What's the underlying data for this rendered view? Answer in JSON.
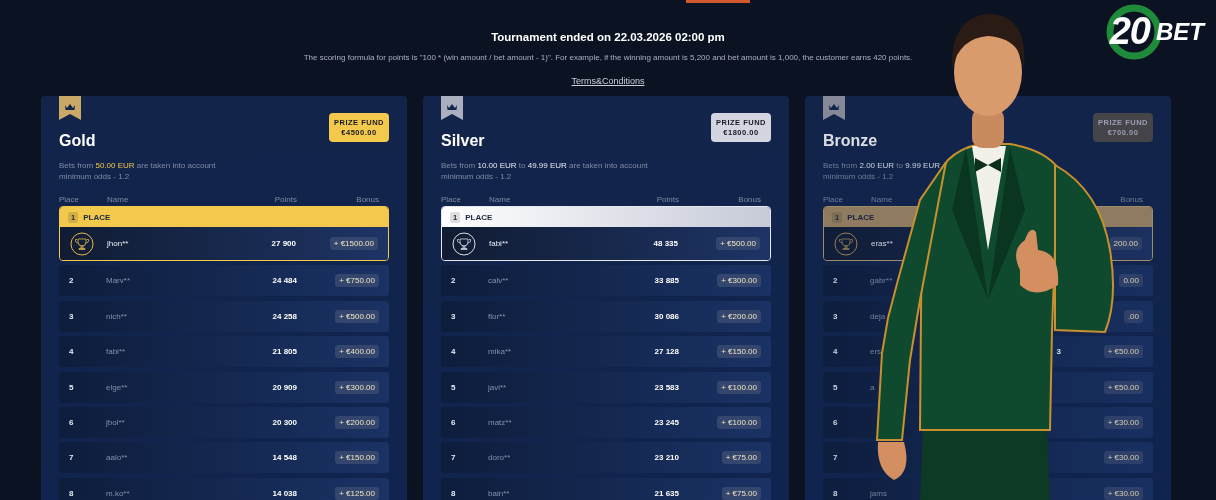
{
  "logo": {
    "number": "20",
    "text": "BET"
  },
  "header": {
    "title": "Tournament ended on 22.03.2026 02:00 pm",
    "formula": "The scoring formula for points is \"100 * (win amount / bet amount - 1)\". For example, if the winning amount is 5,200 and bet amount is 1,000, the customer earns 420 points.",
    "terms_link": "Terms&Conditions"
  },
  "tiers": [
    {
      "kind": "gold",
      "name": "Gold",
      "prize_label": "PRIZE FUND",
      "prize_amount": "€4500.00",
      "description": "Bets from **50.00 EUR** are taken into account",
      "min_odds": "minimum odds - 1.2",
      "columns": {
        "place": "Place",
        "name": "Name",
        "points": "Points",
        "bonus": "Bonus"
      },
      "first_place": {
        "place": "1",
        "label": "PLACE",
        "name": "jhon**",
        "points": "27 900",
        "bonus": "+ €1500.00"
      },
      "rows": [
        {
          "place": "2",
          "name": "Marv**",
          "points": "24 484",
          "bonus": "+ €750.00"
        },
        {
          "place": "3",
          "name": "nich**",
          "points": "24 258",
          "bonus": "+ €500.00"
        },
        {
          "place": "4",
          "name": "fabi**",
          "points": "21 805",
          "bonus": "+ €400.00"
        },
        {
          "place": "5",
          "name": "elge**",
          "points": "20 909",
          "bonus": "+ €300.00"
        },
        {
          "place": "6",
          "name": "jbol**",
          "points": "20 300",
          "bonus": "+ €200.00"
        },
        {
          "place": "7",
          "name": "aalo**",
          "points": "14 548",
          "bonus": "+ €150.00"
        },
        {
          "place": "8",
          "name": "m.ko**",
          "points": "14 038",
          "bonus": "+ €125.00"
        }
      ]
    },
    {
      "kind": "silver",
      "name": "Silver",
      "prize_label": "PRIZE FUND",
      "prize_amount": "€1800.00",
      "description": "Bets from **10.00 EUR** to **49.99 EUR** are taken into account",
      "min_odds": "minimum odds - 1.2",
      "columns": {
        "place": "Place",
        "name": "Name",
        "points": "Points",
        "bonus": "Bonus"
      },
      "first_place": {
        "place": "1",
        "label": "PLACE",
        "name": "fabi**",
        "points": "48 335",
        "bonus": "+ €500.00"
      },
      "rows": [
        {
          "place": "2",
          "name": "calv**",
          "points": "33 885",
          "bonus": "+ €300.00"
        },
        {
          "place": "3",
          "name": "flor**",
          "points": "30 086",
          "bonus": "+ €200.00"
        },
        {
          "place": "4",
          "name": "mika**",
          "points": "27 128",
          "bonus": "+ €150.00"
        },
        {
          "place": "5",
          "name": "javi**",
          "points": "23 583",
          "bonus": "+ €100.00"
        },
        {
          "place": "6",
          "name": "matz**",
          "points": "23 245",
          "bonus": "+ €100.00"
        },
        {
          "place": "7",
          "name": "doro**",
          "points": "23 210",
          "bonus": "+ €75.00"
        },
        {
          "place": "8",
          "name": "bain**",
          "points": "21 635",
          "bonus": "+ €75.00"
        }
      ]
    },
    {
      "kind": "bronze",
      "name": "Bronze",
      "prize_label": "PRIZE FUND",
      "prize_amount": "€700.00",
      "description": "Bets from **2.00 EUR** to **9.99 EUR**",
      "min_odds": "minimum odds - 1.2",
      "columns": {
        "place": "Place",
        "name": "Name",
        "bonus": "Bonus"
      },
      "first_place": {
        "place": "1",
        "label": "PLACE",
        "name": "eras**",
        "bonus": "200.00"
      },
      "rows": [
        {
          "place": "2",
          "name": "gabr**",
          "bonus": "0.00"
        },
        {
          "place": "3",
          "name": "deja",
          "bonus": ".00"
        },
        {
          "place": "4",
          "name": "ers",
          "points": "3",
          "bonus": "+ €50.00"
        },
        {
          "place": "5",
          "name": "a",
          "bonus": "+ €50.00"
        },
        {
          "place": "6",
          "bonus": "+ €30.00"
        },
        {
          "place": "7",
          "bonus": "+ €30.00"
        },
        {
          "place": "8",
          "name": "jams",
          "bonus": "+ €30.00"
        }
      ]
    }
  ]
}
